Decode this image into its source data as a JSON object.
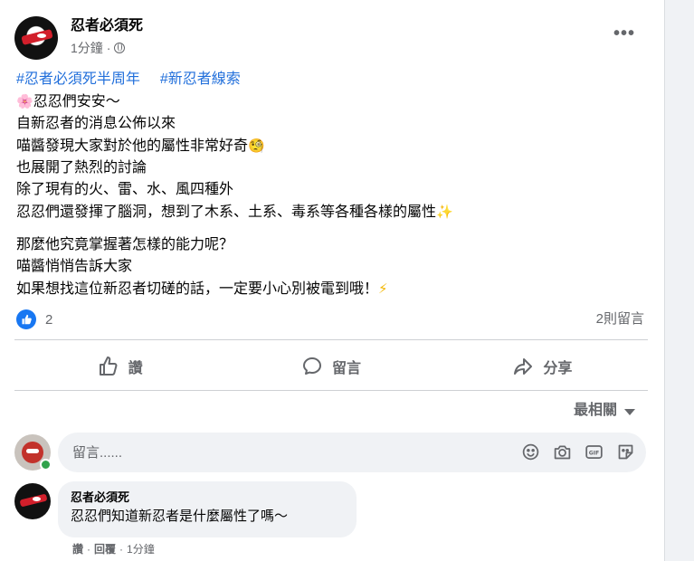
{
  "post": {
    "author": "忍者必須死",
    "timestamp": "1分鐘",
    "separator": "·",
    "privacy_icon": "globe-icon",
    "more_label": "•••",
    "hashtags": [
      "#忍者必須死半周年",
      "#新忍者線索"
    ],
    "lines_block1": [
      "忍忍們安安～",
      "自新忍者的消息公佈以來",
      "喵醬發現大家對於他的屬性非常好奇",
      "也展開了熱烈的討論",
      "除了現有的火、雷、水、風四種外",
      "忍忍們還發揮了腦洞，想到了木系、土系、毒系等各種各樣的屬性"
    ],
    "lines_block2": [
      "那麼他究竟掌握著怎樣的能力呢？",
      "喵醬悄悄告訴大家",
      "如果想找這位新忍者切磋的話，一定要小心別被電到哦！"
    ],
    "emojis": {
      "flower": "🌸",
      "curious": "🧐",
      "sparkle": "✨",
      "bolt": "⚡"
    }
  },
  "stats": {
    "reaction_count": "2",
    "comment_count": "2則留言"
  },
  "actions": {
    "like": "讚",
    "comment": "留言",
    "share": "分享"
  },
  "sort_label": "最相關",
  "composer": {
    "placeholder": "留言......"
  },
  "comment": {
    "author": "忍者必須死",
    "text": "忍忍們知道新忍者是什麼屬性了嗎～",
    "like": "讚",
    "reply": "回覆",
    "time": "1分鐘",
    "sep": "·"
  },
  "colors": {
    "link": "#216fdb",
    "accent": "#1877f2",
    "muted": "#65676b",
    "online": "#31a24c"
  }
}
